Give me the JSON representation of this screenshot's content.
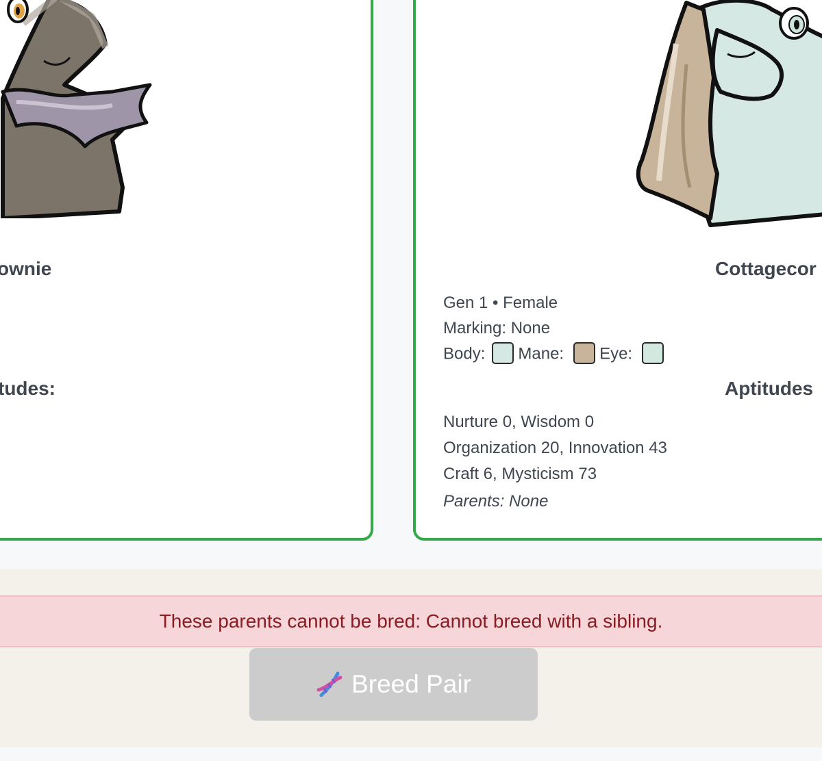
{
  "left_card": {
    "name": "ownie",
    "aptitudes_heading": "tudes:"
  },
  "right_card": {
    "name": "Cottagecor",
    "gen_sex": "Gen 1 • Female",
    "marking": "Marking: None",
    "labels": {
      "body": "Body:",
      "mane": "Mane:",
      "eye": "Eye:"
    },
    "colors": {
      "body": "#d6e8e3",
      "mane": "#c8b49a",
      "eye": "#d3e9df"
    },
    "aptitudes_heading": "Aptitudes",
    "aptitudes": [
      "Nurture 0, Wisdom 0",
      "Organization 20, Innovation 43",
      "Craft 6, Mysticism 73"
    ],
    "parents": "Parents: None"
  },
  "breeding": {
    "error_message": "These parents cannot be bred: Cannot breed with a sibling.",
    "button_label": "Breed Pair",
    "button_icon": "dna-icon"
  }
}
